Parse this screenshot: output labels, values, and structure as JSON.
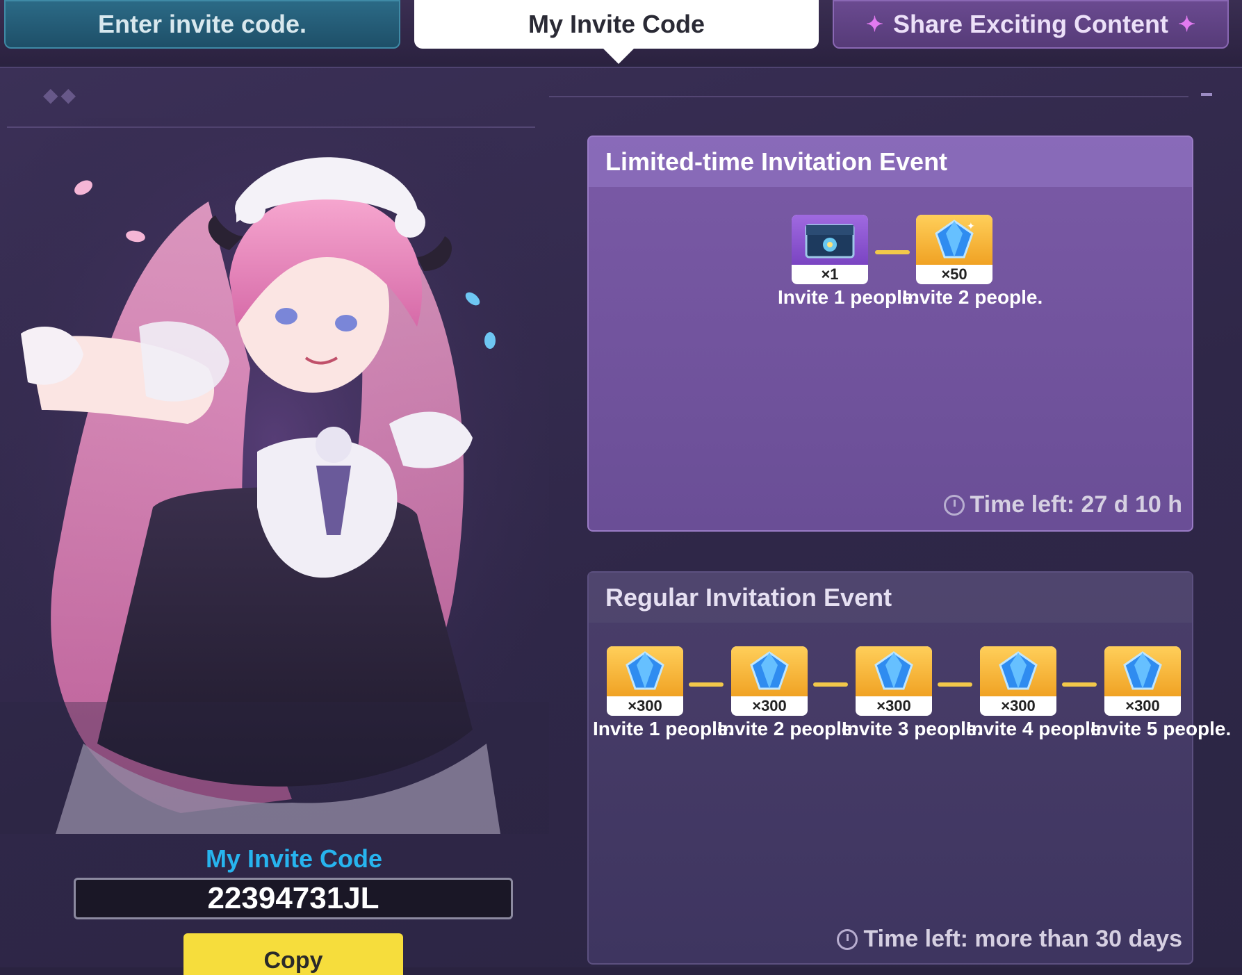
{
  "tabs": {
    "enter_code": "Enter invite code.",
    "my_code": "My Invite Code",
    "share": "Share Exciting Content",
    "share_sparkle": "✦"
  },
  "my_code_panel": {
    "label": "My Invite Code",
    "code": "22394731JL",
    "copy_label": "Copy"
  },
  "limited_event": {
    "title": "Limited-time Invitation Event",
    "rewards": [
      {
        "qty": "×1",
        "label": "Invite 1 people.",
        "icon": "chest-icon"
      },
      {
        "qty": "×50",
        "label": "Invite 2 people.",
        "icon": "crystal-icon"
      }
    ],
    "time_left": "Time left: 27 d 10 h"
  },
  "regular_event": {
    "title": "Regular Invitation Event",
    "rewards": [
      {
        "qty": "×300",
        "label": "Invite 1 people.",
        "icon": "crystal-icon"
      },
      {
        "qty": "×300",
        "label": "Invite 2 people.",
        "icon": "crystal-icon"
      },
      {
        "qty": "×300",
        "label": "Invite 3 people.",
        "icon": "crystal-icon"
      },
      {
        "qty": "×300",
        "label": "Invite 4 people.",
        "icon": "crystal-icon"
      },
      {
        "qty": "×300",
        "label": "Invite 5 people.",
        "icon": "crystal-icon"
      }
    ],
    "time_left": "Time left: more than 30 days"
  },
  "colors": {
    "accent_code_label": "#27b4ee",
    "copy_button": "#f6dd3c",
    "connector": "#f2c84a"
  }
}
